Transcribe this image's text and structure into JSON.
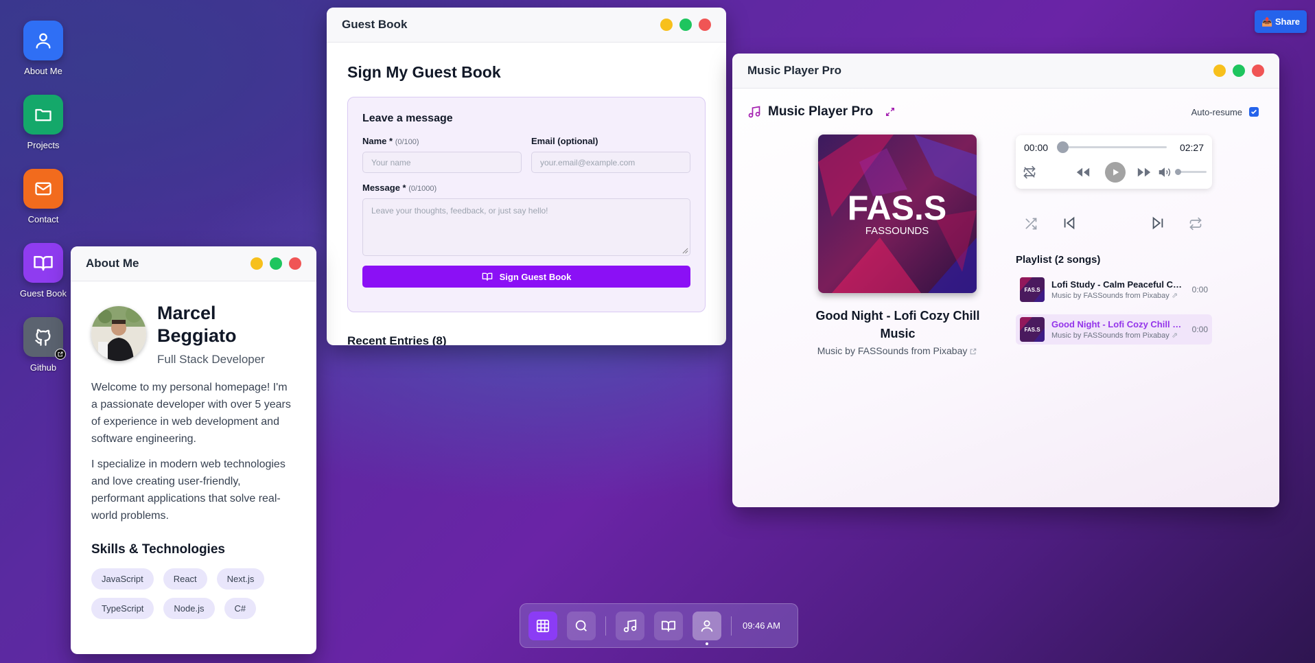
{
  "desktop": {
    "icons": [
      {
        "label": "About Me",
        "icon": "user-icon",
        "color": "#2f6ff5"
      },
      {
        "label": "Projects",
        "icon": "folder-icon",
        "color": "#14a86a"
      },
      {
        "label": "Contact",
        "icon": "mail-icon",
        "color": "#f26b1d"
      },
      {
        "label": "Guest Book",
        "icon": "book-icon",
        "color": "#8f3cf0"
      },
      {
        "label": "Github",
        "icon": "github-icon",
        "color": "#5b6370"
      }
    ]
  },
  "share": {
    "label": "📤 Share"
  },
  "about": {
    "title": "About Me",
    "name": "Marcel Beggiato",
    "role": "Full Stack Developer",
    "para1": "Welcome to my personal homepage! I'm a passionate developer with over 5 years of experience in web development and software engineering.",
    "para2": "I specialize in modern web technologies and love creating user-friendly, performant applications that solve real-world problems.",
    "skills_title": "Skills & Technologies",
    "skills": [
      "JavaScript",
      "React",
      "Next.js",
      "TypeScript",
      "Node.js",
      "C#"
    ]
  },
  "guestbook": {
    "title": "Guest Book",
    "heading": "Sign My Guest Book",
    "card_title": "Leave a message",
    "name_label": "Name *",
    "name_count": "(0/100)",
    "name_placeholder": "Your name",
    "email_label": "Email (optional)",
    "email_placeholder": "your.email@example.com",
    "message_label": "Message *",
    "message_count": "(0/1000)",
    "message_placeholder": "Leave your thoughts, feedback, or just say hello!",
    "submit": "Sign Guest Book",
    "recent": "Recent Entries (8)"
  },
  "music": {
    "title": "Music Player Pro",
    "header": "Music Player Pro",
    "auto_resume": "Auto-resume",
    "auto_resume_checked": true,
    "cover_text": "FAS.S",
    "cover_sub": "FASSOUNDS",
    "song_title": "Good Night - Lofi Cozy Chill Music",
    "song_credit": "Music by FASSounds from Pixabay",
    "time_current": "00:00",
    "time_total": "02:27",
    "progress": 0,
    "playlist_title": "Playlist (2 songs)",
    "playlist": [
      {
        "name": "Lofi Study - Calm Peaceful Chi...",
        "sub": "Music by FASSounds from Pixabay",
        "dur": "0:00",
        "active": false
      },
      {
        "name": "Good Night - Lofi Cozy Chill M...",
        "sub": "Music by FASSounds from Pixabay",
        "dur": "0:00",
        "active": true
      }
    ]
  },
  "taskbar": {
    "clock": "09:46 AM"
  }
}
